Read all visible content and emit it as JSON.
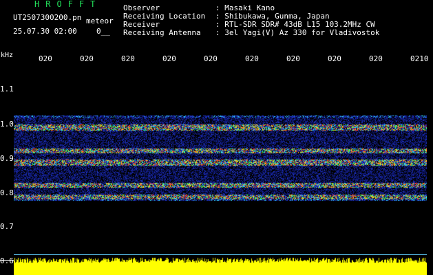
{
  "header": {
    "logo": "HROFFT",
    "filename": "UT2507300200.pn",
    "tag": "meteor",
    "datetime": "25.07.30 02:00",
    "counter": "0__"
  },
  "info": [
    {
      "key": "Observer",
      "value": ": Masaki Kano"
    },
    {
      "key": "Receiving Location",
      "value": ": Shibukawa, Gunma, Japan"
    },
    {
      "key": "Receiver",
      "value": ": RTL-SDR SDR# 43dB L15 103.2MHz CW"
    },
    {
      "key": "Receiving Antenna",
      "value": ": 3el Yagi(V) Az 330 for Vladivostok"
    }
  ],
  "axis": {
    "unit": "kHz",
    "time_ticks": [
      "020",
      "020",
      "020",
      "020",
      "020",
      "020",
      "020",
      "020",
      "020",
      "0210"
    ],
    "freq_ticks": [
      "1.1",
      "1.0",
      "0.9",
      "0.8",
      "0.7",
      "0.6"
    ]
  },
  "colors": {
    "background": "#000000",
    "logo": "#22e05a",
    "noise": "#1b2aa8",
    "hot": "#ff3b1f",
    "warm": "#3cff4a",
    "level_bar": "#ffff00",
    "baseline": "#5fd0ff"
  }
}
